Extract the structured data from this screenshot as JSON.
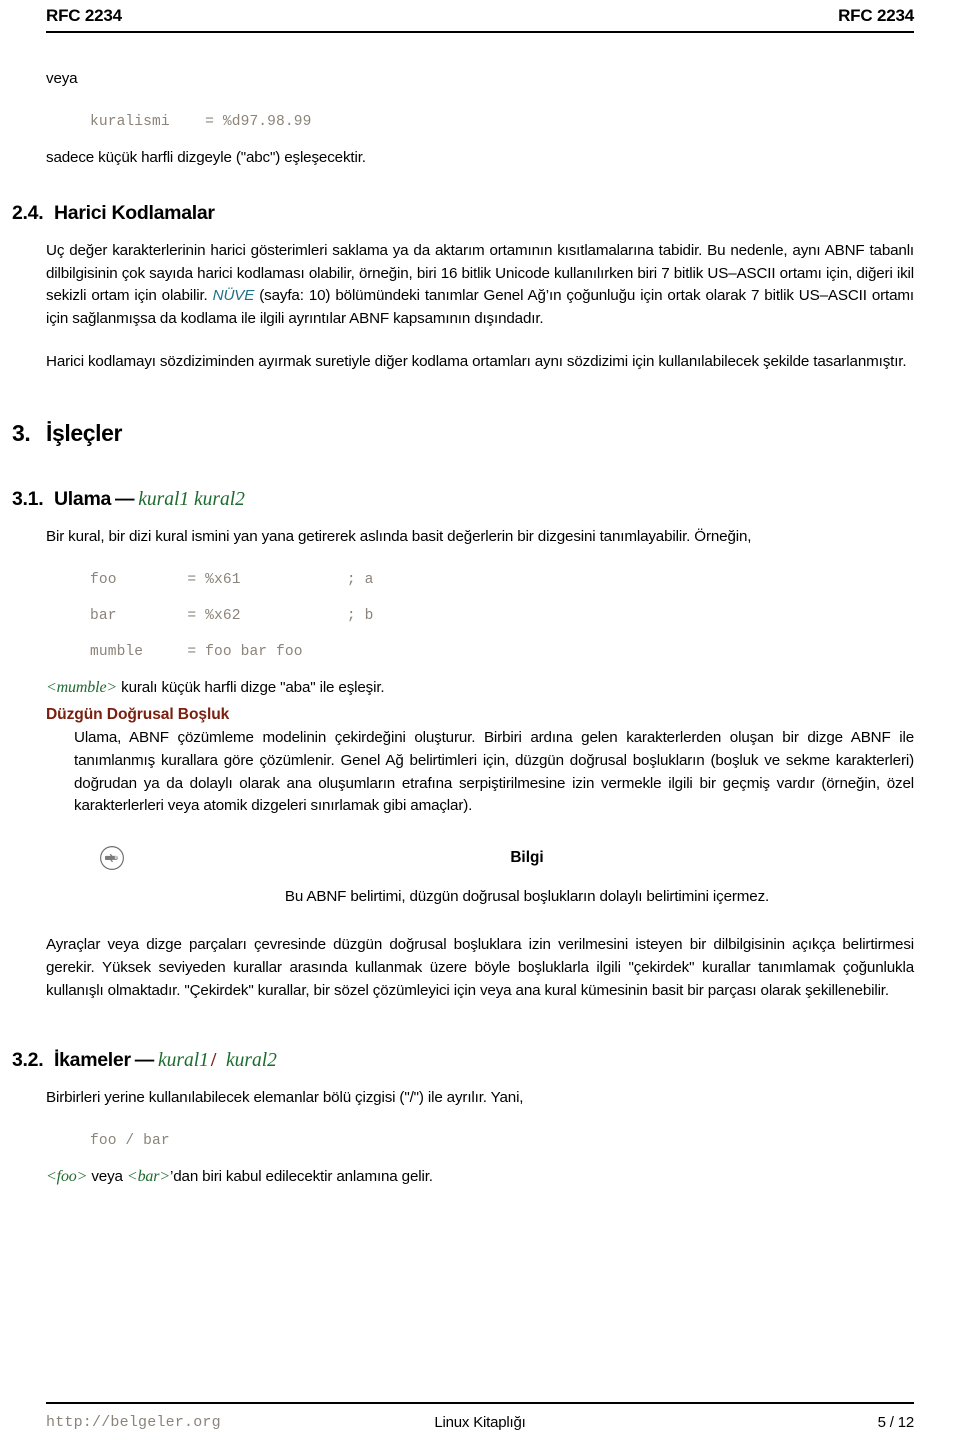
{
  "header": {
    "left": "RFC 2234",
    "right": "RFC 2234"
  },
  "colors": {
    "rule_name_green": "#1d6b2e",
    "slash_red": "#7c1f10",
    "subheading_brown": "#7a2010",
    "code_gray": "#8c847a",
    "link_teal": "#1f6f86"
  },
  "content": {
    "intro_veya": "veya",
    "code_kuralismi": "kuralismi    = %d97.98.99",
    "after_code": "sadece küçük harfli dizgeyle (\"abc\") eşleşecektir.",
    "sec24": {
      "number": "2.4.",
      "title": "Harici Kodlamalar",
      "para1_a": "Uç değer karakterlerinin harici gösterimleri saklama ya da aktarım ortamının kısıtlamalarına tabidir. Bu nedenle, aynı ABNF tabanlı dilbilgisinin çok sayıda harici kodlaması olabilir, örneğin, biri 16 bitlik Unicode kullanılırken biri 7 bitlik US–ASCII ortamı için, diğeri ikil sekizli ortam için olabilir. ",
      "xref_nuve": "NÜVE",
      "para1_b": " (sayfa: 10) bölümündeki tanımlar Genel Ağ’ın çoğunluğu için ortak olarak 7 bitlik US–ASCII ortamı için sağlanmışsa da kodlama ile ilgili ayrıntılar ABNF kapsamının dışındadır.",
      "para2": "Harici kodlamayı sözdiziminden ayırmak suretiyle diğer kodlama ortamları aynı sözdizimi için kullanılabilecek şekilde tasarlanmıştır."
    },
    "sec3": {
      "number": "3.",
      "title": "İşleçler"
    },
    "sec31": {
      "number": "3.1.",
      "title": "Ulama",
      "dash": "—",
      "rule1": "kural1 kural2",
      "para1": "Bir kural, bir dizi kural ismini yan yana getirerek aslında basit değerlerin bir dizgesini tanımlayabilir. Örneğin,",
      "code_foo": "foo        = %x61            ; a",
      "code_bar": "bar        = %x62            ; b",
      "code_mumble": "mumble     = foo bar foo",
      "after_code_rule": "<mumble>",
      "after_code_text": " kuralı küçük harfli dizge \"aba\" ile eşleşir.",
      "sub_title": "Düzgün Doğrusal Boşluk",
      "sub_para": "Ulama, ABNF çözümleme modelinin çekirdeğini oluşturur. Birbiri ardına gelen karakterlerden oluşan bir dizge ABNF ile tanımlanmış kurallara göre çözümlenir. Genel Ağ belirtimleri için, düzgün doğrusal boşlukların (boşluk ve sekme karakterleri) doğrudan ya da dolaylı olarak ana oluşumların etrafına serpiştirilmesine izin vermekle ilgili bir geçmiş vardır (örneğin, özel karakterlerleri veya atomik dizgeleri sınırlamak gibi amaçlar).",
      "note": {
        "icon": "pointing-hand-icon",
        "title": "Bilgi",
        "body": "Bu ABNF belirtimi, düzgün doğrusal boşlukların dolaylı belirtimini içermez."
      },
      "para_after_note": "Ayraçlar veya dizge parçaları çevresinde düzgün doğrusal boşluklara izin verilmesini isteyen bir dilbilgisinin açıkça belirtirmesi gerekir. Yüksek seviyeden kurallar arasında kullanmak üzere böyle boşluklarla ilgili \"çekirdek\" kurallar tanımlamak çoğunlukla kullanışlı olmaktadır. \"Çekirdek\" kurallar, bir sözel çözümleyici için veya ana kural kümesinin basit bir parçası olarak şekillenebilir."
    },
    "sec32": {
      "number": "3.2.",
      "title": "İkameler",
      "dash": "—",
      "rule_a": "kural1",
      "slash": "/",
      "rule_b": "kural2",
      "para1": "Birbirleri yerine kullanılabilecek elemanlar bölü çizgisi (\"/\") ile ayrılır. Yani,",
      "code_foobar": "foo / bar",
      "closing_rule_a": "<foo>",
      "closing_mid": " veya ",
      "closing_rule_b": "<bar>",
      "closing_tail": "’dan biri kabul edilecektir anlamına gelir."
    }
  },
  "footer": {
    "url": "http://belgeler.org",
    "center": "Linux Kitaplığı",
    "page": "5 / 12"
  }
}
